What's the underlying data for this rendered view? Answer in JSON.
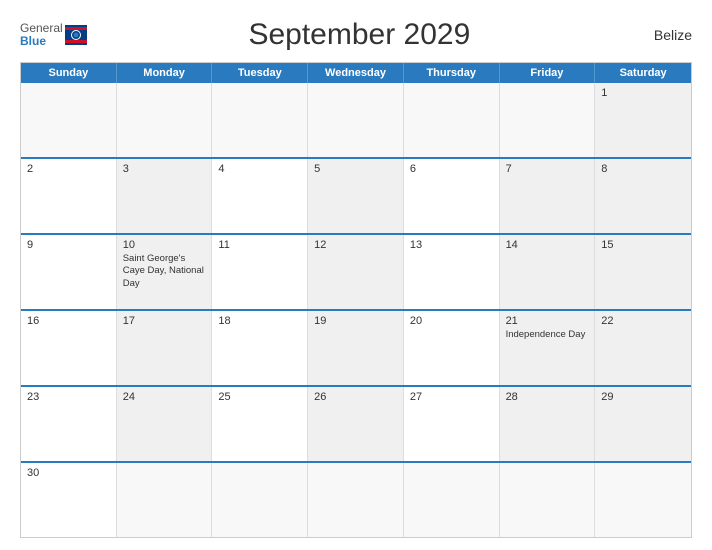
{
  "header": {
    "logo_general": "General",
    "logo_blue": "Blue",
    "title": "September 2029",
    "country": "Belize"
  },
  "weekdays": [
    "Sunday",
    "Monday",
    "Tuesday",
    "Wednesday",
    "Thursday",
    "Friday",
    "Saturday"
  ],
  "rows": [
    [
      {
        "day": "",
        "empty": true,
        "gray": false
      },
      {
        "day": "",
        "empty": true,
        "gray": false
      },
      {
        "day": "",
        "empty": true,
        "gray": false
      },
      {
        "day": "",
        "empty": true,
        "gray": false
      },
      {
        "day": "",
        "empty": true,
        "gray": false
      },
      {
        "day": "",
        "empty": true,
        "gray": false
      },
      {
        "day": "1",
        "empty": false,
        "gray": true,
        "event": ""
      }
    ],
    [
      {
        "day": "2",
        "empty": false,
        "gray": false,
        "event": ""
      },
      {
        "day": "3",
        "empty": false,
        "gray": true,
        "event": ""
      },
      {
        "day": "4",
        "empty": false,
        "gray": false,
        "event": ""
      },
      {
        "day": "5",
        "empty": false,
        "gray": true,
        "event": ""
      },
      {
        "day": "6",
        "empty": false,
        "gray": false,
        "event": ""
      },
      {
        "day": "7",
        "empty": false,
        "gray": true,
        "event": ""
      },
      {
        "day": "8",
        "empty": false,
        "gray": true,
        "event": ""
      }
    ],
    [
      {
        "day": "9",
        "empty": false,
        "gray": false,
        "event": ""
      },
      {
        "day": "10",
        "empty": false,
        "gray": true,
        "event": "Saint George's\nCaye Day, National Day"
      },
      {
        "day": "11",
        "empty": false,
        "gray": false,
        "event": ""
      },
      {
        "day": "12",
        "empty": false,
        "gray": true,
        "event": ""
      },
      {
        "day": "13",
        "empty": false,
        "gray": false,
        "event": ""
      },
      {
        "day": "14",
        "empty": false,
        "gray": true,
        "event": ""
      },
      {
        "day": "15",
        "empty": false,
        "gray": true,
        "event": ""
      }
    ],
    [
      {
        "day": "16",
        "empty": false,
        "gray": false,
        "event": ""
      },
      {
        "day": "17",
        "empty": false,
        "gray": true,
        "event": ""
      },
      {
        "day": "18",
        "empty": false,
        "gray": false,
        "event": ""
      },
      {
        "day": "19",
        "empty": false,
        "gray": true,
        "event": ""
      },
      {
        "day": "20",
        "empty": false,
        "gray": false,
        "event": ""
      },
      {
        "day": "21",
        "empty": false,
        "gray": true,
        "event": "Independence Day"
      },
      {
        "day": "22",
        "empty": false,
        "gray": true,
        "event": ""
      }
    ],
    [
      {
        "day": "23",
        "empty": false,
        "gray": false,
        "event": ""
      },
      {
        "day": "24",
        "empty": false,
        "gray": true,
        "event": ""
      },
      {
        "day": "25",
        "empty": false,
        "gray": false,
        "event": ""
      },
      {
        "day": "26",
        "empty": false,
        "gray": true,
        "event": ""
      },
      {
        "day": "27",
        "empty": false,
        "gray": false,
        "event": ""
      },
      {
        "day": "28",
        "empty": false,
        "gray": true,
        "event": ""
      },
      {
        "day": "29",
        "empty": false,
        "gray": true,
        "event": ""
      }
    ],
    [
      {
        "day": "30",
        "empty": false,
        "gray": false,
        "event": ""
      },
      {
        "day": "",
        "empty": true,
        "gray": false
      },
      {
        "day": "",
        "empty": true,
        "gray": false
      },
      {
        "day": "",
        "empty": true,
        "gray": false
      },
      {
        "day": "",
        "empty": true,
        "gray": false
      },
      {
        "day": "",
        "empty": true,
        "gray": false
      },
      {
        "day": "",
        "empty": true,
        "gray": false
      }
    ]
  ]
}
